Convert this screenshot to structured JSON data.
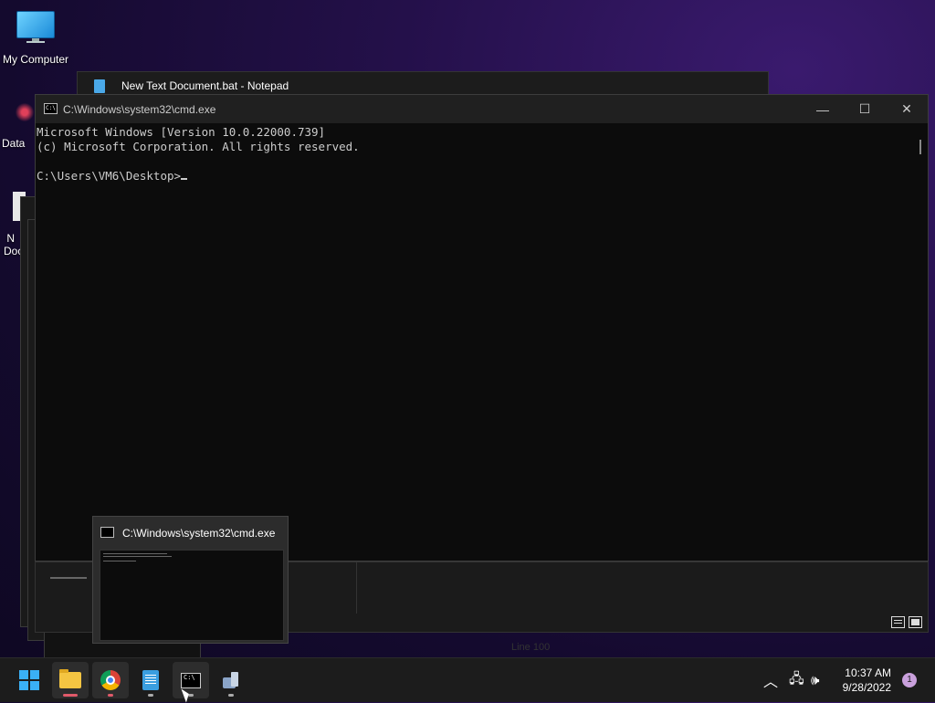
{
  "desktop": {
    "icons": [
      {
        "label": "My Computer"
      },
      {
        "label": "DataW"
      },
      {
        "label": "N Doc"
      }
    ]
  },
  "notepad_window": {
    "title": "New Text Document.bat - Notepad"
  },
  "cmd_window": {
    "title": "C:\\Windows\\system32\\cmd.exe",
    "lines": [
      "Microsoft Windows [Version 10.0.22000.739]",
      "(c) Microsoft Corporation. All rights reserved.",
      "",
      "C:\\Users\\VM6\\Desktop>"
    ],
    "controls": {
      "minimize": "—",
      "maximize": "☐",
      "close": "✕"
    }
  },
  "thumbnail": {
    "title": "C:\\Windows\\system32\\cmd.exe"
  },
  "background_status": {
    "text": "Line 100"
  },
  "taskbar": {
    "apps": [
      {
        "name": "start",
        "icon": "windows-logo-icon"
      },
      {
        "name": "file-explorer",
        "icon": "folder-icon"
      },
      {
        "name": "chrome",
        "icon": "chrome-icon"
      },
      {
        "name": "notepad",
        "icon": "notepad-icon"
      },
      {
        "name": "cmd",
        "icon": "cmd-icon"
      },
      {
        "name": "tool",
        "icon": "tool-icon"
      }
    ],
    "tray": {
      "chevron": "^",
      "time": "10:37 AM",
      "date": "9/28/2022",
      "notifications": "1"
    }
  },
  "colors": {
    "accent": "#3ab0f5",
    "terminal_bg": "#0c0c0c",
    "terminal_fg": "#cccccc"
  }
}
